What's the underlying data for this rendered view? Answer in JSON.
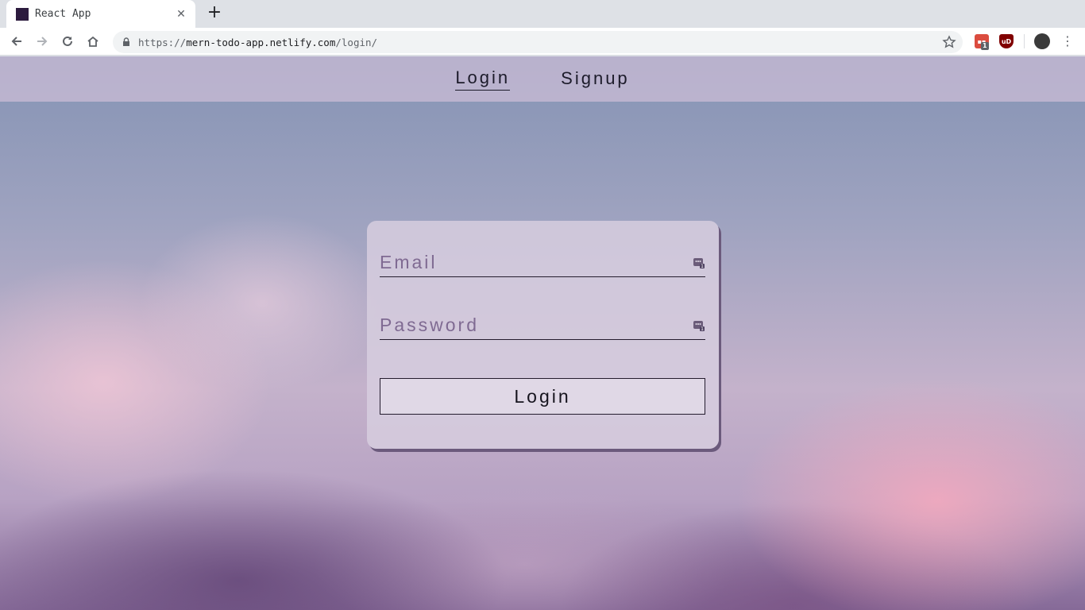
{
  "browser": {
    "tab": {
      "title": "React App"
    },
    "url": {
      "prefix": "https://",
      "host": "mern-todo-app.netlify.com",
      "path": "/login/"
    },
    "extensions": [
      {
        "name": "todoist-extension",
        "color": "#db4c3f",
        "badge": "1"
      },
      {
        "name": "ublock-origin-extension",
        "color": "#800000",
        "label": "uD"
      }
    ]
  },
  "nav": {
    "links": [
      {
        "label": "Login",
        "active": true
      },
      {
        "label": "Signup",
        "active": false
      }
    ]
  },
  "login_form": {
    "email_placeholder": "Email",
    "password_placeholder": "Password",
    "submit_label": "Login"
  }
}
